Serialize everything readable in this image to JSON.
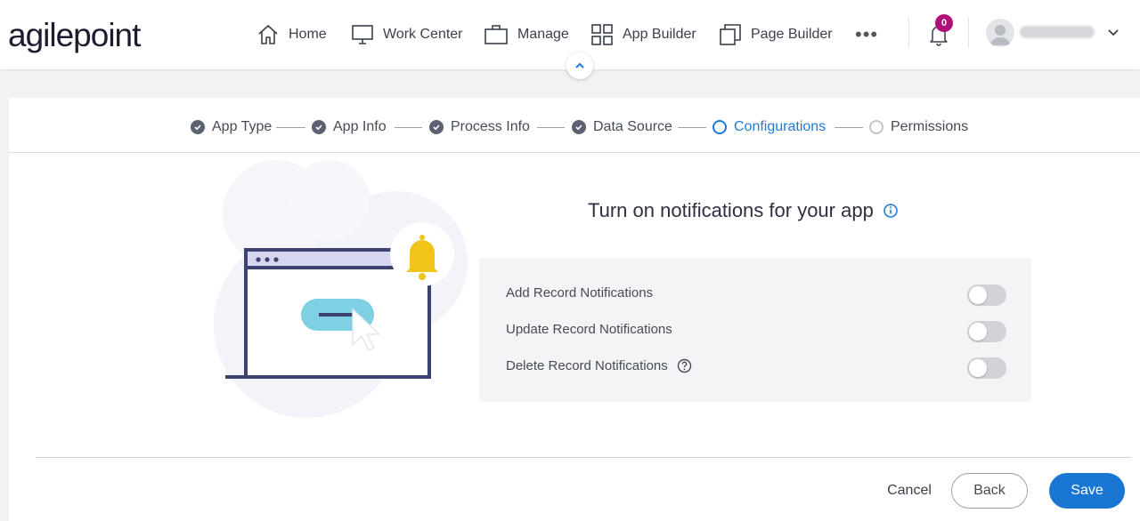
{
  "app": {
    "logo_text": "agilepoint"
  },
  "nav": {
    "items": [
      {
        "label": "Home",
        "icon": "home-icon"
      },
      {
        "label": "Work Center",
        "icon": "monitor-icon"
      },
      {
        "label": "Manage",
        "icon": "briefcase-icon"
      },
      {
        "label": "App Builder",
        "icon": "grid-icon"
      },
      {
        "label": "Page Builder",
        "icon": "pages-icon"
      }
    ],
    "more_label": "•••",
    "notification_count": "0"
  },
  "stepper": {
    "steps": [
      {
        "label": "App Type",
        "state": "done"
      },
      {
        "label": "App Info",
        "state": "done"
      },
      {
        "label": "Process Info",
        "state": "done"
      },
      {
        "label": "Data Source",
        "state": "done"
      },
      {
        "label": "Configurations",
        "state": "active"
      },
      {
        "label": "Permissions",
        "state": "pending"
      }
    ]
  },
  "main": {
    "heading": "Turn on notifications for your app",
    "options": [
      {
        "label": "Add Record Notifications",
        "enabled": false,
        "help": false
      },
      {
        "label": "Update Record Notifications",
        "enabled": false,
        "help": false
      },
      {
        "label": "Delete Record Notifications",
        "enabled": false,
        "help": true
      }
    ]
  },
  "footer": {
    "cancel_label": "Cancel",
    "back_label": "Back",
    "save_label": "Save"
  },
  "colors": {
    "accent": "#1976d2",
    "badge": "#b0107a",
    "bell": "#f0c419",
    "illustration_navy": "#3b4270"
  }
}
